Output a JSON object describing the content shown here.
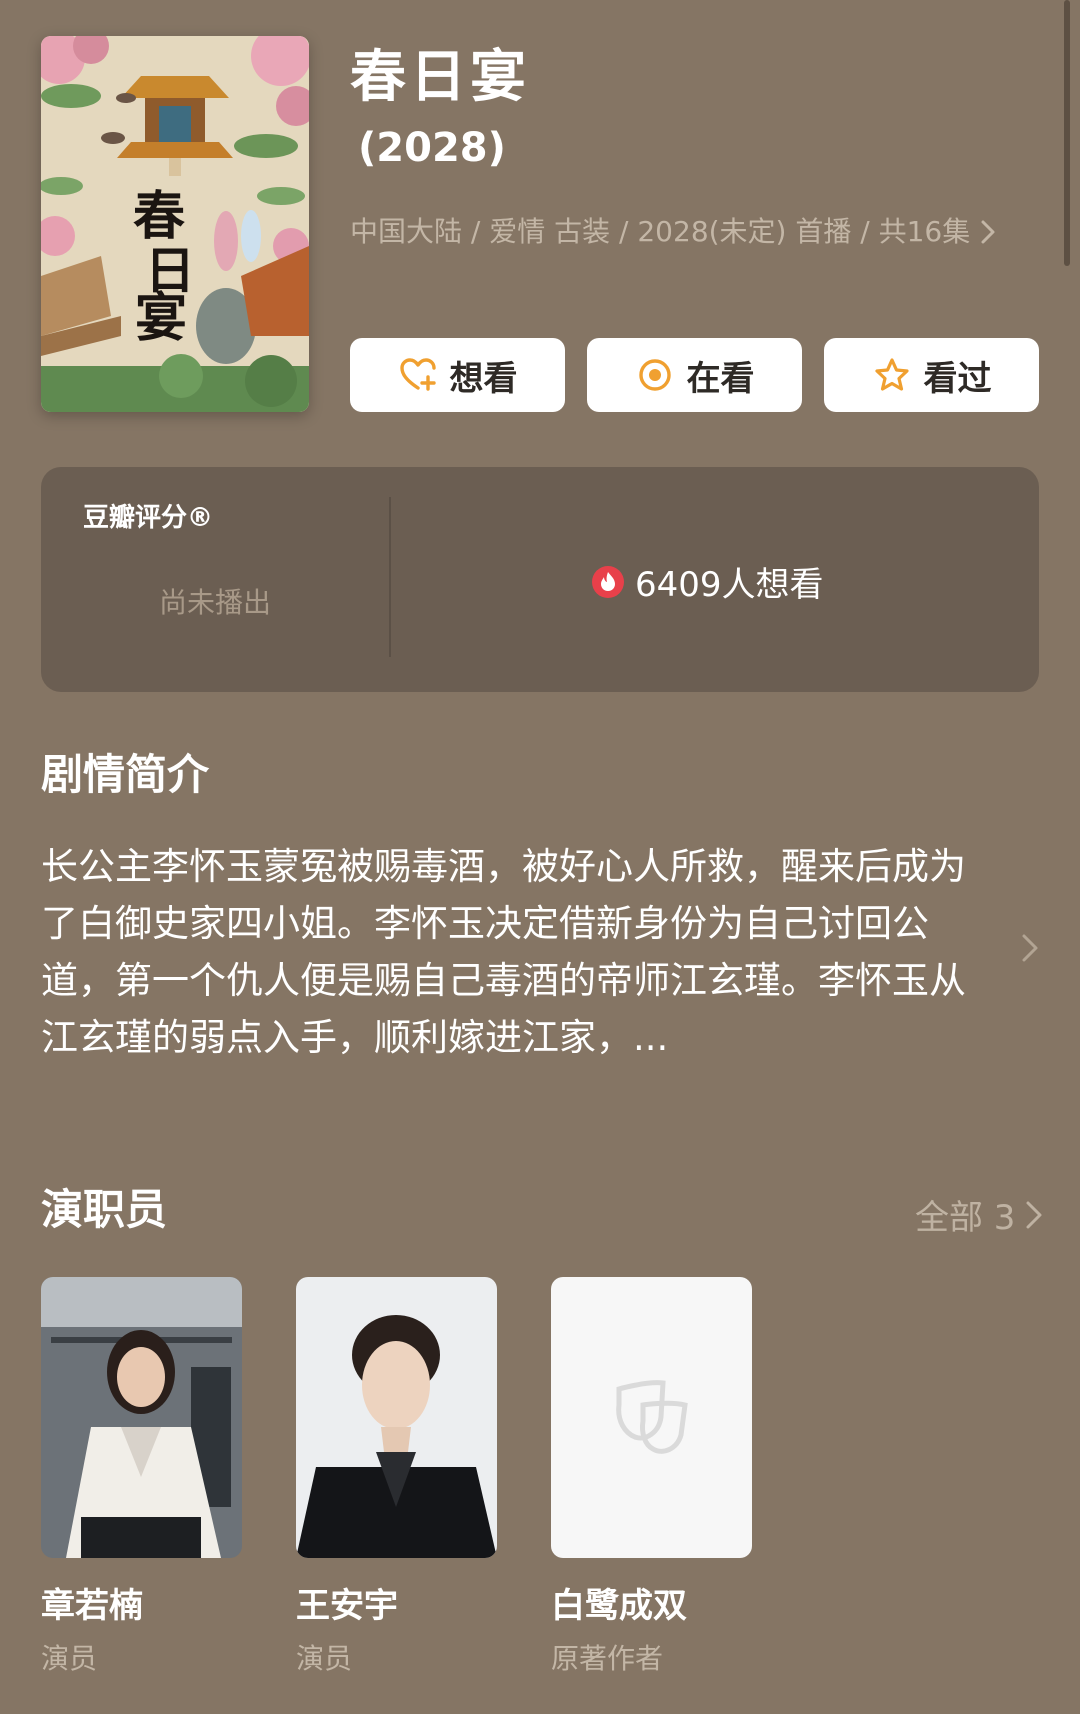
{
  "show": {
    "title": "春日宴",
    "year": "(2028)",
    "meta": "中国大陆 / 爱情 古装 / 2028(未定) 首播 / 共16集"
  },
  "actions": [
    {
      "label": "想看",
      "icon": "heart-plus-icon"
    },
    {
      "label": "在看",
      "icon": "target-circle-icon"
    },
    {
      "label": "看过",
      "icon": "star-outline-icon"
    }
  ],
  "rating": {
    "label": "豆瓣评分®",
    "status": "尚未播出",
    "want_count": "6409人想看"
  },
  "synopsis": {
    "title": "剧情简介",
    "text": "长公主李怀玉蒙冤被赐毒酒，被好心人所救，醒来后成为了白御史家四小姐。李怀玉决定借新身份为自己讨回公道，第一个仇人便是赐自己毒酒的帝师江玄瑾。李怀玉从江玄瑾的弱点入手，顺利嫁进江家，..."
  },
  "cast": {
    "title": "演职员",
    "all_label": "全部 3",
    "members": [
      {
        "name": "章若楠",
        "role": "演员"
      },
      {
        "name": "王安宇",
        "role": "演员"
      },
      {
        "name": "白鹭成双",
        "role": "原著作者"
      }
    ]
  },
  "colors": {
    "background": "#857564",
    "card": "#6b5e52",
    "accent_orange": "#f0a030",
    "fire_red": "#e8404a"
  }
}
